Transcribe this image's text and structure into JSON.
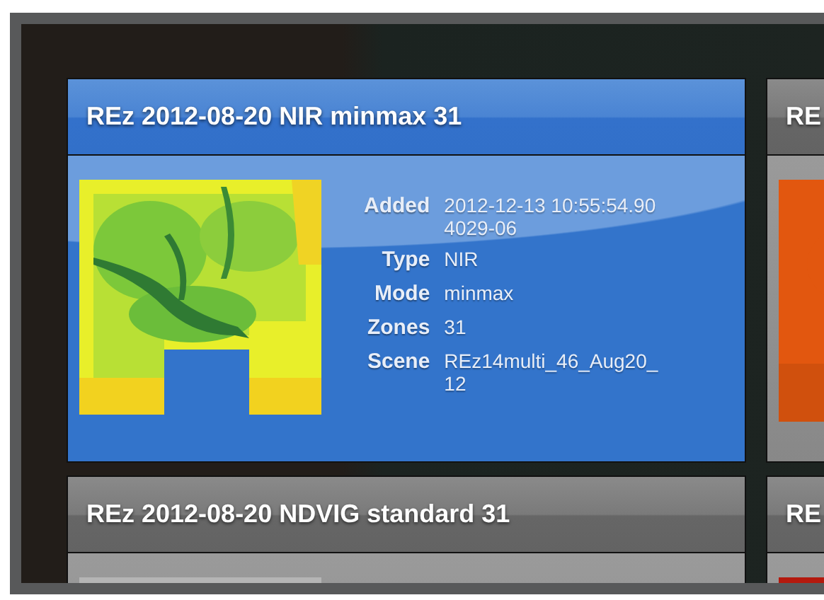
{
  "cards": [
    {
      "title": "REz 2012-08-20 NIR minmax 31",
      "selected": true,
      "details": [
        {
          "label": "Added",
          "lines": [
            "2012-12-13 10:55:54.90",
            "4029-06"
          ]
        },
        {
          "label": "Type",
          "lines": [
            "NIR"
          ]
        },
        {
          "label": "Mode",
          "lines": [
            "minmax"
          ]
        },
        {
          "label": "Zones",
          "lines": [
            "31"
          ]
        },
        {
          "label": "Scene",
          "lines": [
            "REz14multi_46_Aug20_",
            "12"
          ]
        }
      ]
    },
    {
      "title": "RE",
      "selected": false
    },
    {
      "title": "REz 2012-08-20 NDVIG standard 31",
      "selected": false
    },
    {
      "title": "RE",
      "selected": false
    }
  ]
}
